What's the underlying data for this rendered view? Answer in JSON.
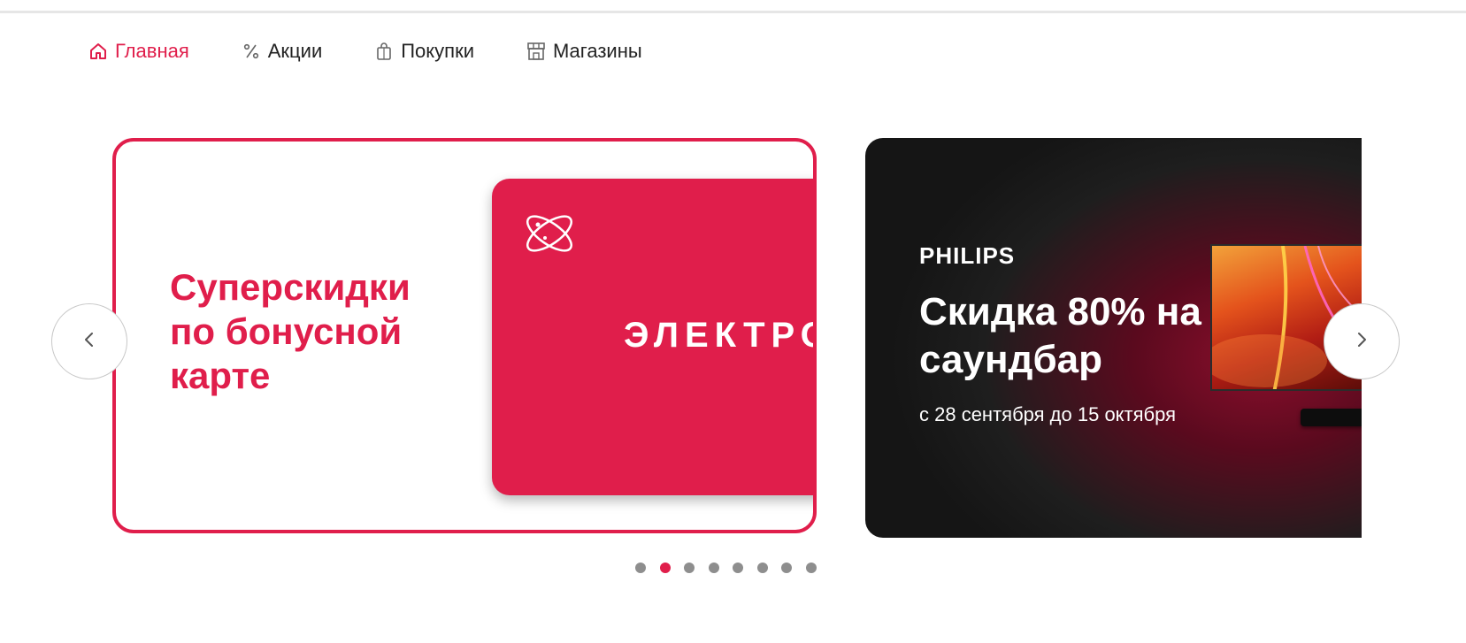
{
  "nav": {
    "items": [
      {
        "label": "Главная",
        "icon": "home-icon",
        "active": true
      },
      {
        "label": "Акции",
        "icon": "percent-icon",
        "active": false
      },
      {
        "label": "Покупки",
        "icon": "shopping-bag-icon",
        "active": false
      },
      {
        "label": "Магазины",
        "icon": "store-icon",
        "active": false
      }
    ]
  },
  "colors": {
    "accent": "#e01e4b",
    "text": "#222222",
    "dot_inactive": "#8e8e8e",
    "dark_banner": "#151515"
  },
  "slides": [
    {
      "title": "Суперскидки по бонусной карте",
      "card_text": "ЭЛЕКТРО"
    },
    {
      "brand": "PHILIPS",
      "title": "Скидка 80% на саундбар",
      "subtitle": "с 28 сентября до 15 октября"
    }
  ],
  "pagination": {
    "total": 8,
    "active_index": 1
  },
  "controls": {
    "prev_icon": "chevron-left-icon",
    "next_icon": "chevron-right-icon"
  }
}
